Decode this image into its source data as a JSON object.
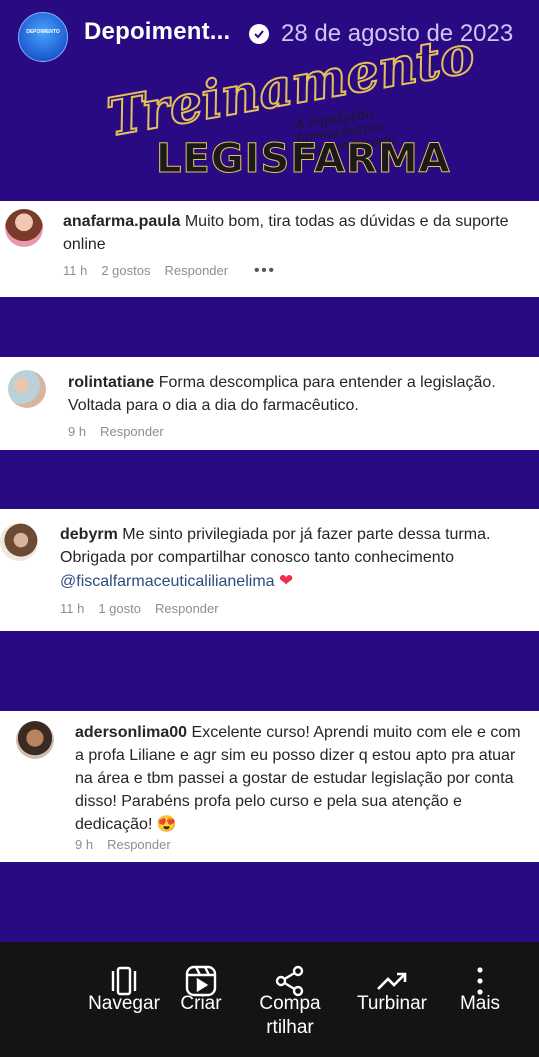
{
  "header": {
    "channel_name": "Depoiment...",
    "date": "28 de agosto de 2023",
    "avatar_text": "DEPOIMENTO"
  },
  "banner": {
    "title": "Treinamento",
    "subtitle_line1": "A legislação farmacêutica",
    "subtitle_line2": "descomplicada",
    "brand": "LEGISFARMA"
  },
  "comments": [
    {
      "user": "anafarma.paula",
      "text": "Muito bom, tira todas as dúvidas e da suporte online",
      "time": "11 h",
      "likes": "2 gostos",
      "reply": "Responder",
      "more": "•••"
    },
    {
      "user": "rolintatiane",
      "text": "Forma descomplica para entender a legislação. Voltada para o dia a dia do farmacêutico.",
      "time": "9 h",
      "reply": "Responder"
    },
    {
      "user": "debyrm",
      "text": "Me sinto privilegiada por já fazer parte dessa turma. Obrigada por compartilhar conosco tanto conhecimento",
      "mention": "@fiscalfarmaceuticalilianelima",
      "emoji": "❤",
      "time": "11 h",
      "likes": "1 gosto",
      "reply": "Responder"
    },
    {
      "user": "adersonlima00",
      "text": "Excelente curso! Aprendi muito com ele e com a profa Liliane e agr sim eu posso dizer q estou apto pra atuar na área e tbm passei a gostar de estudar legislação por conta disso! Parabéns profa pelo curso e pela sua atenção e dedicação!",
      "emoji": "😍",
      "time": "9 h",
      "reply": "Responder"
    }
  ],
  "bottom_nav": [
    {
      "label": "Navegar",
      "icon": "browse-icon"
    },
    {
      "label": "Criar",
      "icon": "reels-icon"
    },
    {
      "label": "Compa\nrtilhar",
      "icon": "share-icon"
    },
    {
      "label": "Turbinar",
      "icon": "trending-icon"
    },
    {
      "label": "Mais",
      "icon": "more-vertical-icon"
    }
  ],
  "colors": {
    "background": "#2a0a82",
    "gold": "#e2c15a",
    "heart": "#ef2d52"
  }
}
